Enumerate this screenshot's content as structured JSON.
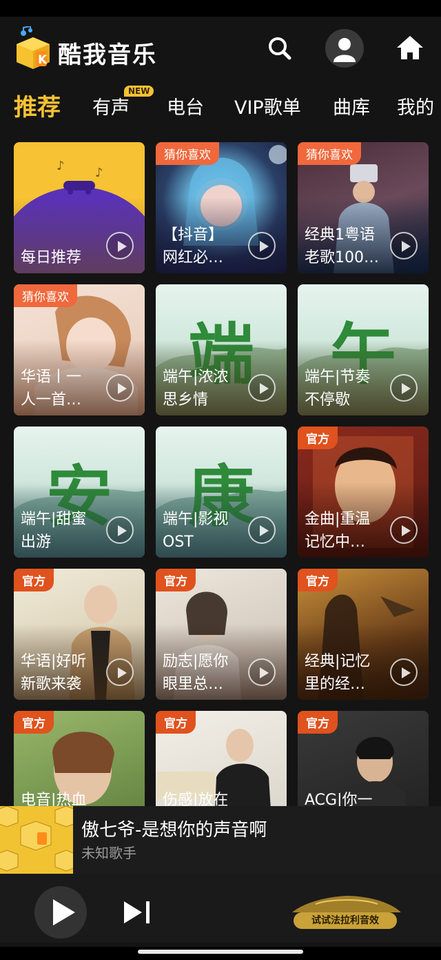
{
  "app": {
    "title": "酷我音乐"
  },
  "tabs": [
    {
      "label": "推荐",
      "active": true
    },
    {
      "label": "有声",
      "badge": "NEW"
    },
    {
      "label": "电台"
    },
    {
      "label": "VIP歌单"
    },
    {
      "label": "曲库"
    },
    {
      "label": "我的"
    }
  ],
  "cards": [
    {
      "tag": "",
      "line1": "每日推荐",
      "line2": "",
      "icon": "daily-recommend-art"
    },
    {
      "tag": "猜你喜欢",
      "line1": "【抖音】",
      "line2": "网红必…"
    },
    {
      "tag": "猜你喜欢",
      "line1": "经典1粤语",
      "line2": "老歌100…"
    },
    {
      "tag": "猜你喜欢",
      "line1": "华语丨一",
      "line2": "人一首…"
    },
    {
      "tag": "",
      "line1": "端午|浓浓",
      "line2": "思乡情",
      "big_char": "端"
    },
    {
      "tag": "",
      "line1": "端午|节奏",
      "line2": "不停歇",
      "big_char": "午"
    },
    {
      "tag": "",
      "line1": "端午|甜蜜",
      "line2": "出游",
      "big_char": "安"
    },
    {
      "tag": "",
      "line1": "端午|影视",
      "line2": "OST",
      "big_char": "康"
    },
    {
      "tag": "官方",
      "line1": "金曲|重温",
      "line2": "记忆中…"
    },
    {
      "tag": "官方",
      "line1": "华语|好听",
      "line2": "新歌来袭"
    },
    {
      "tag": "官方",
      "line1": "励志|愿你",
      "line2": "眼里总…"
    },
    {
      "tag": "官方",
      "line1": "经典|记忆",
      "line2": "里的经…"
    },
    {
      "tag": "官方",
      "line1": "电音|热血",
      "line2": ""
    },
    {
      "tag": "官方",
      "line1": "伤感|放在",
      "line2": ""
    },
    {
      "tag": "官方",
      "line1": "ACG|你一",
      "line2": ""
    }
  ],
  "now_playing": {
    "song": "傲七爷-是想你的声音啊",
    "artist": "未知歌手"
  },
  "controls": {
    "ferrari_label": "试试法拉利音效"
  },
  "colors": {
    "accent": "#f7c233",
    "official_tag": "#e0521e",
    "guess_tag": "#f0683c",
    "background": "#141414"
  }
}
